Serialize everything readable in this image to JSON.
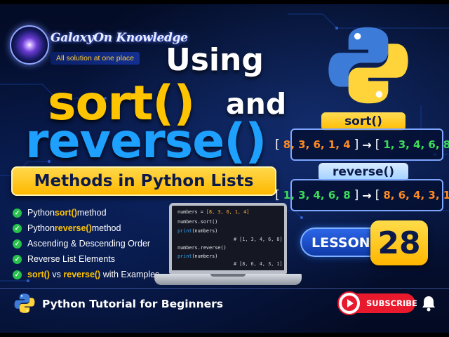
{
  "brand": {
    "name": "GalaxyOn Knowledge",
    "tagline": "All solution at one place",
    "logo_icon": "galaxy-icon"
  },
  "title": {
    "line1": "Using",
    "method1": "sort()",
    "connector": "and",
    "method2": "reverse()",
    "subtitle": "Methods in Python Lists"
  },
  "colors": {
    "yellow": "#ffc400",
    "blue": "#1ea0ff",
    "red": "#e8192c",
    "green_check": "#27c24c",
    "orange_values": "#ff8a24",
    "green_values": "#3ddc5a",
    "background": "#06143c"
  },
  "examples": {
    "sort": {
      "label": "sort()",
      "input": "8, 3, 6, 1, 4",
      "output": "1, 3, 4, 6, 8"
    },
    "reverse": {
      "label": "reverse()",
      "input": "1, 3, 4, 6, 8",
      "output": "8, 6, 4, 3, 1"
    }
  },
  "lesson": {
    "label": "LESSON",
    "number": "28"
  },
  "topics": [
    {
      "pre": "Python ",
      "hl": "sort()",
      "post": " method",
      "mid": "",
      "hl2": ""
    },
    {
      "pre": "Python ",
      "hl": "reverse()",
      "post": " method",
      "mid": "",
      "hl2": ""
    },
    {
      "pre": "Ascending & Descending Order",
      "hl": "",
      "post": "",
      "mid": "",
      "hl2": ""
    },
    {
      "pre": "Reverse List Elements",
      "hl": "",
      "post": "",
      "mid": "",
      "hl2": ""
    },
    {
      "pre": "",
      "hl": "sort()",
      "mid": " vs ",
      "hl2": "reverse()",
      "post": " with Examples"
    }
  ],
  "code": {
    "line1_a": "numbers = ",
    "line1_b": "[8, 3, 6, 1, 4]",
    "line2": "numbers.sort()",
    "line3_fn": "print",
    "line3_arg": "(numbers)",
    "comment1": "# [1, 3, 4, 6, 8]",
    "line5": "numbers.reverse()",
    "line6_fn": "print",
    "line6_arg": "(numbers)",
    "comment2": "# [8, 6, 4, 3, 1]"
  },
  "footer": {
    "title": "Python Tutorial for Beginners",
    "subscribe_label": "SUBSCRIBE",
    "python_icon": "python-icon",
    "play_icon": "play-icon",
    "bell_icon": "bell-icon"
  }
}
